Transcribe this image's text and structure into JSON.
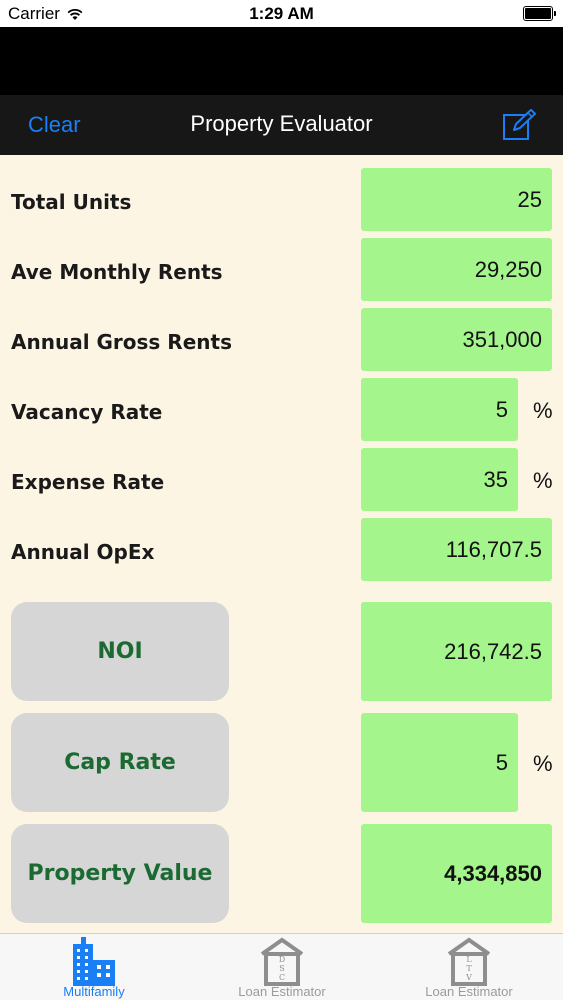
{
  "status_bar": {
    "carrier": "Carrier",
    "time": "1:29 AM"
  },
  "navbar": {
    "clear_label": "Clear",
    "title": "Property Evaluator",
    "edit_icon": "compose-icon"
  },
  "fields": [
    {
      "label": "Total Units",
      "value": "25",
      "unit": ""
    },
    {
      "label": "Ave Monthly Rents",
      "value": "29,250",
      "unit": ""
    },
    {
      "label": "Annual Gross Rents",
      "value": "351,000",
      "unit": ""
    },
    {
      "label": "Vacancy Rate",
      "value": "5",
      "unit": "%"
    },
    {
      "label": "Expense Rate",
      "value": "35",
      "unit": "%"
    },
    {
      "label": "Annual OpEx",
      "value": "116,707.5",
      "unit": ""
    }
  ],
  "calculations": [
    {
      "label": "NOI",
      "value": "216,742.5",
      "unit": ""
    },
    {
      "label": "Cap Rate",
      "value": "5",
      "unit": "%"
    },
    {
      "label": "Property Value",
      "value": "4,334,850",
      "unit": ""
    }
  ],
  "tabs": [
    {
      "label": "Multifamily",
      "icon": "building-icon",
      "active": true
    },
    {
      "label": "Loan Estimator",
      "icon": "dsc-house-icon",
      "active": false
    },
    {
      "label": "Loan Estimator",
      "icon": "ltv-house-icon",
      "active": false
    }
  ],
  "colors": {
    "accent": "#1a7ff5",
    "field_green": "#a3f58c",
    "background": "#fdf5e4",
    "button_text": "#1b6a31"
  }
}
